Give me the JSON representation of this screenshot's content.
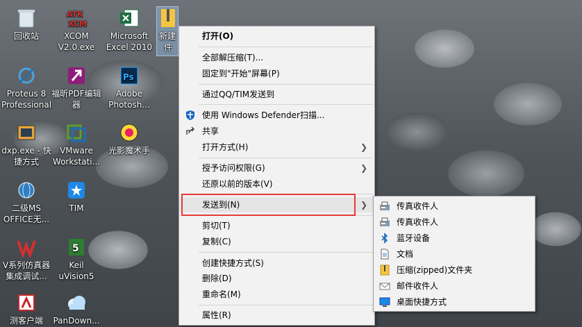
{
  "desktop": {
    "icons": [
      {
        "label_line1": "回收站",
        "label_line2": ""
      },
      {
        "label_line1": "XCOM",
        "label_line2": "V2.0.exe"
      },
      {
        "label_line1": "Microsoft",
        "label_line2": "Excel 2010"
      },
      {
        "label_line1": "新建",
        "label_line2": "件"
      },
      {
        "label_line1": "Proteus 8",
        "label_line2": "Professional"
      },
      {
        "label_line1": "福昕PDF编辑",
        "label_line2": "器"
      },
      {
        "label_line1": "Adobe",
        "label_line2": "Photosh..."
      },
      {
        "label_line1": "dxp.exe - 快",
        "label_line2": "捷方式"
      },
      {
        "label_line1": "VMware",
        "label_line2": "Workstati..."
      },
      {
        "label_line1": "光影魔术手",
        "label_line2": ""
      },
      {
        "label_line1": "二级MS",
        "label_line2": "OFFICE无..."
      },
      {
        "label_line1": "TIM",
        "label_line2": ""
      },
      {
        "label_line1": "V系列仿真器",
        "label_line2": "集成调试..."
      },
      {
        "label_line1": "Keil",
        "label_line2": "uVision5"
      },
      {
        "label_line1": "测客户端",
        "label_line2": ""
      },
      {
        "label_line1": "PanDown...",
        "label_line2": ""
      }
    ]
  },
  "context_menu": {
    "open": "打开(O)",
    "extract_all": "全部解压缩(T)...",
    "pin_start": "固定到\"开始\"屏幕(P)",
    "send_qq": "通过QQ/TIM发送到",
    "defender": "使用 Windows Defender扫描...",
    "share": "共享",
    "open_with": "打开方式(H)",
    "grant_access": "授予访问权限(G)",
    "restore": "还原以前的版本(V)",
    "send_to": "发送到(N)",
    "cut": "剪切(T)",
    "copy": "复制(C)",
    "create_shortcut": "创建快捷方式(S)",
    "delete": "删除(D)",
    "rename": "重命名(M)",
    "properties": "属性(R)"
  },
  "submenu": {
    "items": [
      {
        "label": "传真收件人",
        "icon": "fax-icon"
      },
      {
        "label": "传真收件人",
        "icon": "fax-icon"
      },
      {
        "label": "蓝牙设备",
        "icon": "bluetooth-icon"
      },
      {
        "label": "文档",
        "icon": "document-icon"
      },
      {
        "label": "压缩(zipped)文件夹",
        "icon": "zip-folder-icon"
      },
      {
        "label": "邮件收件人",
        "icon": "mail-icon"
      },
      {
        "label": "桌面快捷方式",
        "icon": "desktop-icon"
      }
    ]
  },
  "colors": {
    "highlight_border": "#e53935",
    "menu_bg": "#f2f2f2"
  }
}
